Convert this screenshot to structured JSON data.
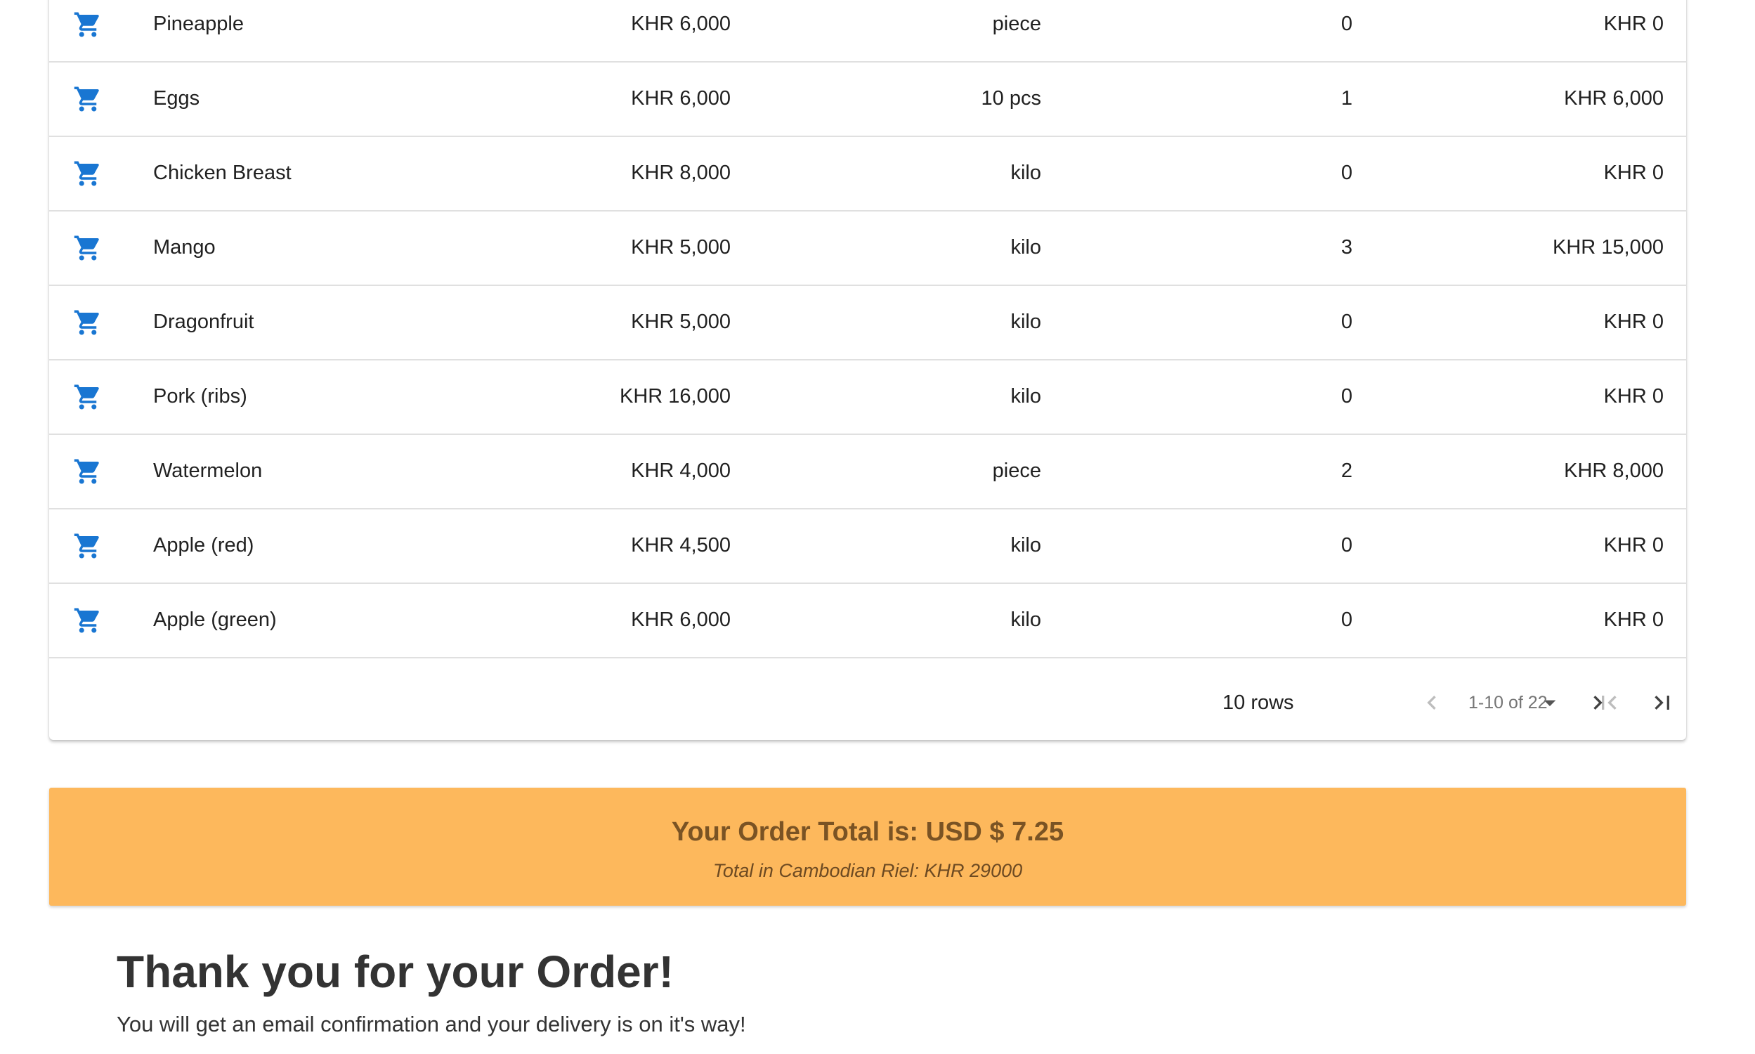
{
  "colors": {
    "accent": "#1976d2",
    "order_total_bg": "#fdb85c",
    "order_total_text": "#7a5324"
  },
  "cart_icon": "shopping-cart-icon",
  "rows": [
    {
      "name": "Pineapple",
      "price": "KHR 6,000",
      "unit": "piece",
      "qty": "0",
      "total": "KHR 0"
    },
    {
      "name": "Eggs",
      "price": "KHR 6,000",
      "unit": "10 pcs",
      "qty": "1",
      "total": "KHR 6,000"
    },
    {
      "name": "Chicken Breast",
      "price": "KHR 8,000",
      "unit": "kilo",
      "qty": "0",
      "total": "KHR 0"
    },
    {
      "name": "Mango",
      "price": "KHR 5,000",
      "unit": "kilo",
      "qty": "3",
      "total": "KHR 15,000"
    },
    {
      "name": "Dragonfruit",
      "price": "KHR 5,000",
      "unit": "kilo",
      "qty": "0",
      "total": "KHR 0"
    },
    {
      "name": "Pork (ribs)",
      "price": "KHR 16,000",
      "unit": "kilo",
      "qty": "0",
      "total": "KHR 0"
    },
    {
      "name": "Watermelon",
      "price": "KHR 4,000",
      "unit": "piece",
      "qty": "2",
      "total": "KHR 8,000"
    },
    {
      "name": "Apple (red)",
      "price": "KHR 4,500",
      "unit": "kilo",
      "qty": "0",
      "total": "KHR 0"
    },
    {
      "name": "Apple (green)",
      "price": "KHR 6,000",
      "unit": "kilo",
      "qty": "0",
      "total": "KHR 0"
    }
  ],
  "pagination": {
    "rows_per_page": "10 rows",
    "range": "1-10 of 22"
  },
  "order_total": {
    "main": "Your Order Total is: USD $ 7.25",
    "sub": "Total in Cambodian Riel: KHR 29000"
  },
  "thanks": {
    "title": "Thank you for your Order!",
    "text": "You will get an email confirmation and your delivery is on it's way!"
  }
}
